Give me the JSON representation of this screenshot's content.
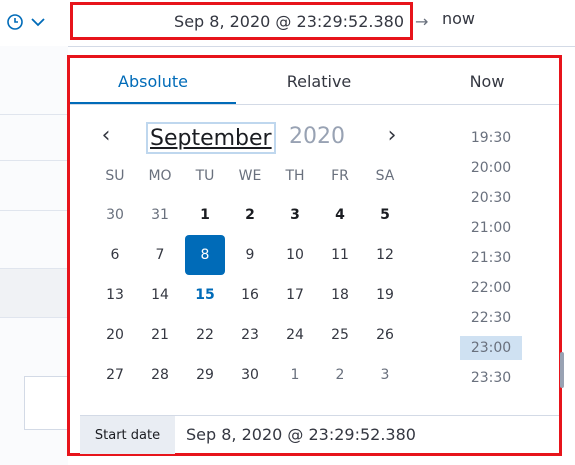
{
  "date_picker": {
    "start_value": "Sep 8, 2020 @ 23:29:52.380",
    "arrow": "→",
    "end_value": "now",
    "quick_menu_icons": [
      "clock-icon",
      "chevron-down-icon"
    ]
  },
  "popover": {
    "tabs": [
      {
        "label": "Absolute",
        "active": true
      },
      {
        "label": "Relative",
        "active": false
      },
      {
        "label": "Now",
        "active": false
      }
    ],
    "calendar": {
      "prev": "‹",
      "next": "›",
      "month": "September",
      "year": "2020",
      "weekdays": [
        "SU",
        "MO",
        "TU",
        "WE",
        "TH",
        "FR",
        "SA"
      ],
      "weeks": [
        [
          "30",
          "31",
          "1",
          "2",
          "3",
          "4",
          "5"
        ],
        [
          "6",
          "7",
          "8",
          "9",
          "10",
          "11",
          "12"
        ],
        [
          "13",
          "14",
          "15",
          "16",
          "17",
          "18",
          "19"
        ],
        [
          "20",
          "21",
          "22",
          "23",
          "24",
          "25",
          "26"
        ],
        [
          "27",
          "28",
          "29",
          "30",
          "1",
          "2",
          "3"
        ]
      ],
      "selected_day": "8",
      "today_day": "15"
    },
    "times": [
      "19:30",
      "20:00",
      "20:30",
      "21:00",
      "21:30",
      "22:00",
      "22:30",
      "23:00",
      "23:30"
    ],
    "selected_time": "23:00",
    "footer": {
      "label": "Start date",
      "value": "Sep 8, 2020 @ 23:29:52.380"
    }
  },
  "colors": {
    "accent": "#006bb8",
    "highlight_border": "#e7141b",
    "selected_time_bg": "#cfe1f2"
  }
}
